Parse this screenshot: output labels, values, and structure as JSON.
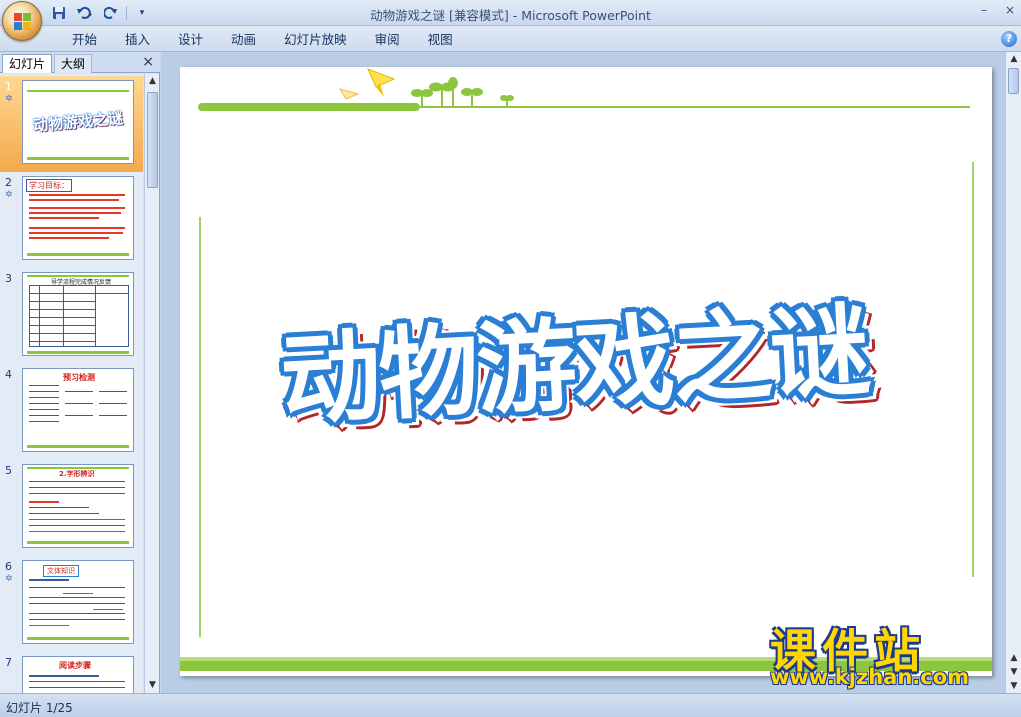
{
  "window": {
    "title": "动物游戏之谜 [兼容模式] - Microsoft PowerPoint",
    "minimize": "–",
    "close": "×"
  },
  "ribbon": {
    "tabs": [
      "开始",
      "插入",
      "设计",
      "动画",
      "幻灯片放映",
      "审阅",
      "视图"
    ],
    "help": "?"
  },
  "left_pane": {
    "tab_slides": "幻灯片",
    "tab_outline": "大纲",
    "close": "×",
    "slides": [
      {
        "number": "1",
        "selected": true,
        "title": "动物游戏之谜"
      },
      {
        "number": "2",
        "selected": false,
        "title": "学习目标："
      },
      {
        "number": "3",
        "selected": false,
        "title": "导学流程完成情况反馈"
      },
      {
        "number": "4",
        "selected": false,
        "title": "预习检测"
      },
      {
        "number": "5",
        "selected": false,
        "title": "2.字形辨识"
      },
      {
        "number": "6",
        "selected": false,
        "title": "文体知识"
      },
      {
        "number": "7",
        "selected": false,
        "title": "阅读步骤"
      }
    ]
  },
  "slide": {
    "title": "动物游戏之谜"
  },
  "status": {
    "slide_indicator": "幻灯片 1/25"
  },
  "watermark": {
    "brand": "课件站",
    "url": "www.kjzhan.com"
  },
  "colors": {
    "accent_green": "#8cc63f",
    "title_blue": "#2a7fd4",
    "title_red": "#b3262a",
    "watermark_yellow": "#ffd700"
  }
}
